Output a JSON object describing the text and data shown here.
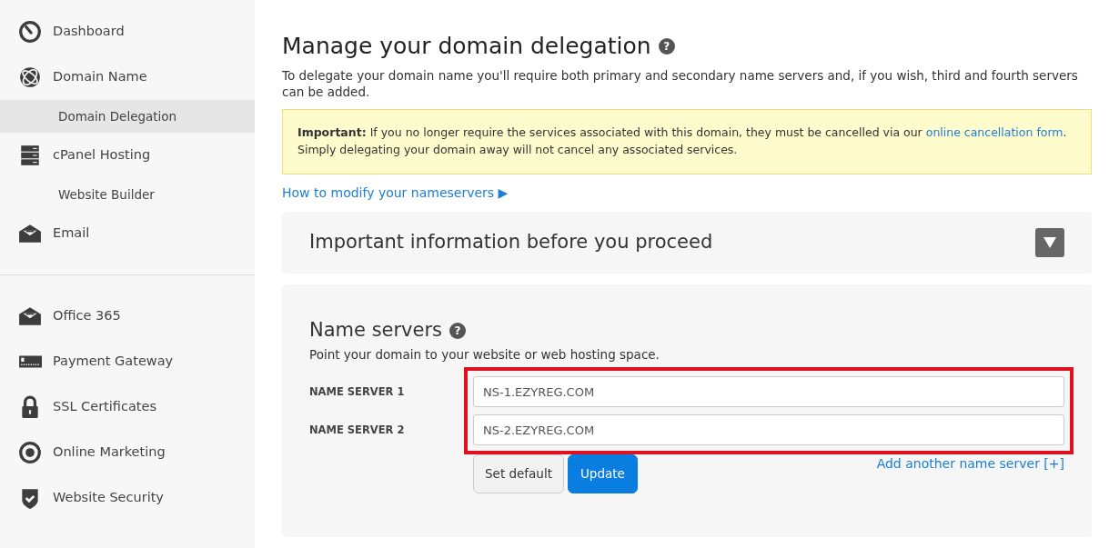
{
  "sidebar": {
    "groups": [
      {
        "items": [
          {
            "kind": "main",
            "label": "Dashboard",
            "selected": false
          },
          {
            "kind": "main",
            "label": "Domain Name",
            "selected": false
          },
          {
            "kind": "sub",
            "label": "Domain Delegation",
            "selected": true
          },
          {
            "kind": "main",
            "label": "cPanel Hosting",
            "selected": false
          },
          {
            "kind": "sub",
            "label": "Website Builder",
            "selected": false
          },
          {
            "kind": "main",
            "label": "Email",
            "selected": false
          }
        ]
      },
      {
        "items": [
          {
            "kind": "main",
            "label": "Office 365",
            "selected": false
          },
          {
            "kind": "main",
            "label": "Payment Gateway",
            "selected": false
          },
          {
            "kind": "main",
            "label": "SSL Certificates",
            "selected": false
          },
          {
            "kind": "main",
            "label": "Online Marketing",
            "selected": false
          },
          {
            "kind": "main",
            "label": "Website Security",
            "selected": false
          }
        ]
      }
    ]
  },
  "page": {
    "title": "Manage your domain delegation",
    "title_help": "?",
    "intro": "To delegate your domain name you'll require both primary and secondary name servers and, if you wish, third and fourth servers can be added.",
    "alert": {
      "lead": "Important:",
      "text_before": "If you no longer require the services associated with this domain, they must be cancelled via our",
      "link": "online cancellation form",
      "text_after": ". Simply delegating your domain away will not cancel any associated services."
    },
    "howto_link": "How to modify your nameservers ▶",
    "info_panel": {
      "title": "Important information before you proceed",
      "expanded": false
    },
    "name_servers": {
      "title": "Name servers",
      "title_help": "?",
      "subtitle": "Point your domain to your website or web hosting space.",
      "highlighted": true,
      "fields": [
        {
          "label": "NAME SERVER 1",
          "value": "NS-1.EZYREG.COM"
        },
        {
          "label": "NAME SERVER 2",
          "value": "NS-2.EZYREG.COM"
        }
      ],
      "buttons": [
        {
          "kind": "secondary",
          "label": "Set default"
        },
        {
          "kind": "primary",
          "label": "Update"
        }
      ],
      "add_link": "Add another name server [+]"
    }
  }
}
